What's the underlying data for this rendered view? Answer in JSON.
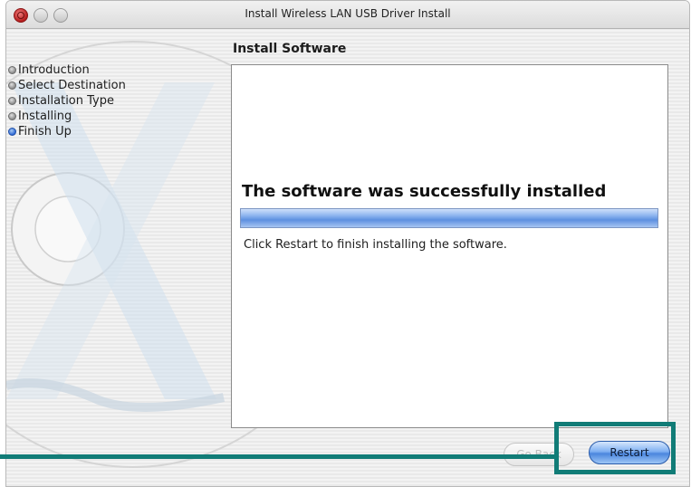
{
  "window": {
    "title": "Install Wireless LAN USB Driver Install"
  },
  "sidebar": {
    "steps": [
      {
        "label": "Introduction",
        "active": false
      },
      {
        "label": "Select Destination",
        "active": false
      },
      {
        "label": "Installation Type",
        "active": false
      },
      {
        "label": "Installing",
        "active": false
      },
      {
        "label": "Finish Up",
        "active": true
      }
    ]
  },
  "main": {
    "section_title": "Install Software",
    "headline": "The software was successfully installed",
    "progress_percent": 100,
    "instruction": "Click Restart to finish installing the software."
  },
  "buttons": {
    "back_label": "Go Back",
    "restart_label": "Restart"
  },
  "icons": {
    "close": "close-icon",
    "minimize": "minimize-icon",
    "zoom": "zoom-icon",
    "step_bullet": "step-bullet-icon"
  },
  "colors": {
    "callout": "#117c77",
    "progress_fill": "#5d90e0",
    "default_button": "#4b86de"
  }
}
